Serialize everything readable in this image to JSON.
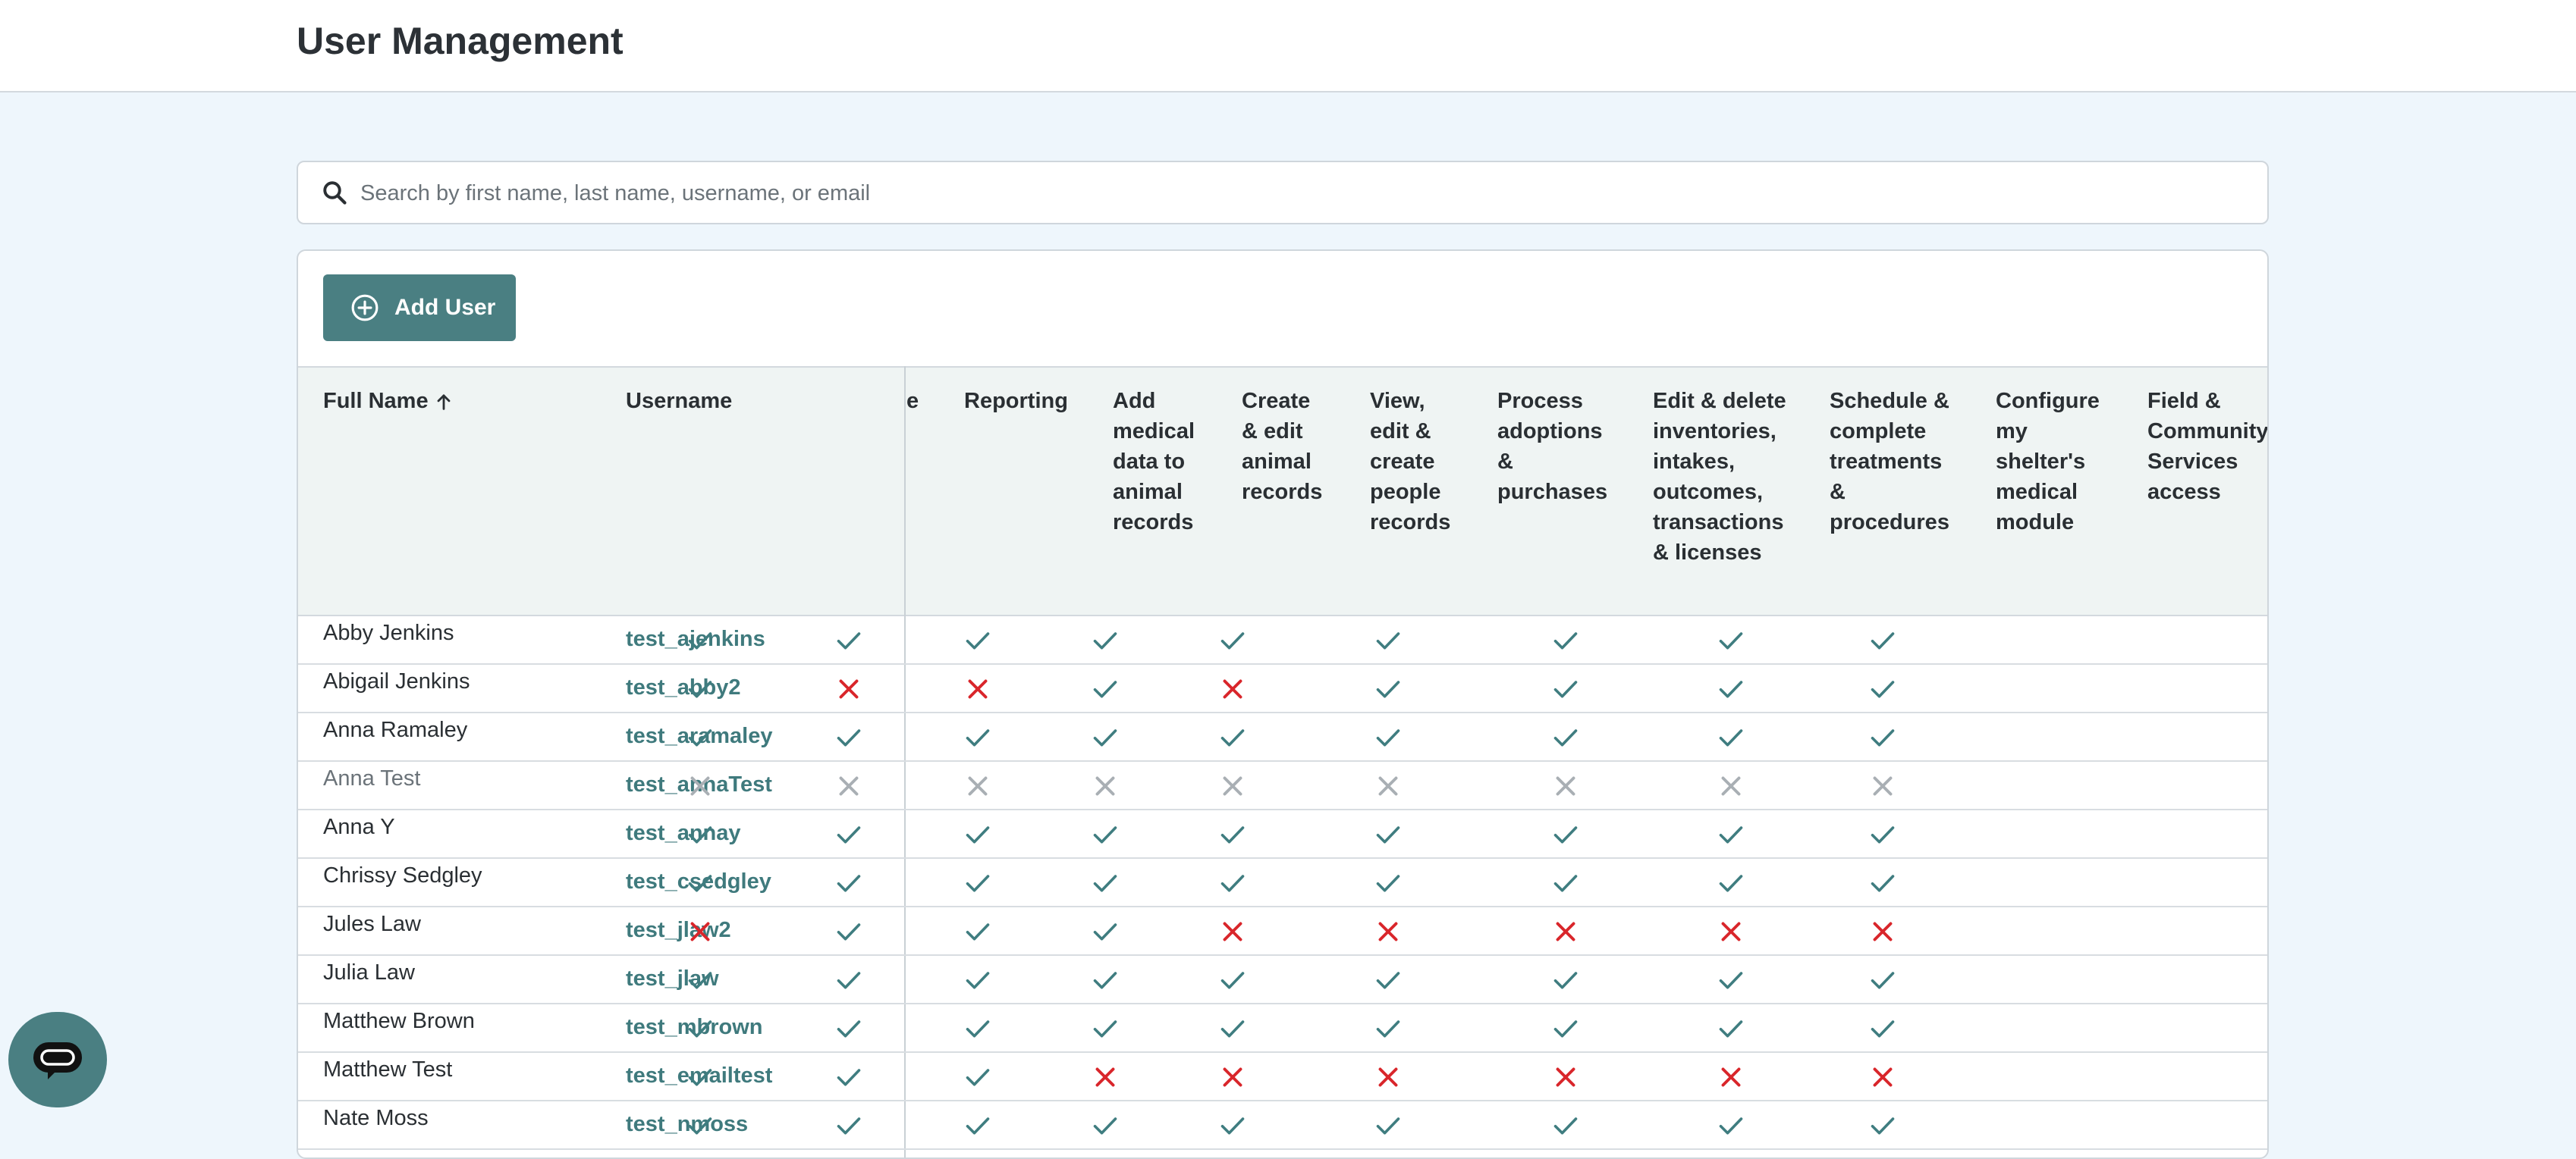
{
  "page": {
    "title": "User Management"
  },
  "search": {
    "placeholder": "Search by first name, last name, username, or email"
  },
  "toolbar": {
    "add_user_label": "Add User"
  },
  "table": {
    "columns": {
      "full_name": "Full Name",
      "username": "Username",
      "partial": "e",
      "permissions": [
        [
          "Reporting"
        ],
        [
          "Add",
          "medical",
          "data to",
          "animal",
          "records"
        ],
        [
          "Create",
          "& edit",
          "animal",
          "records"
        ],
        [
          "View,",
          "edit &",
          "create",
          "people",
          "records"
        ],
        [
          "Process",
          "adoptions",
          "&",
          "purchases"
        ],
        [
          "Edit & delete",
          "inventories,",
          "intakes,",
          "outcomes,",
          "transactions",
          "& licenses"
        ],
        [
          "Schedule &",
          "complete",
          "treatments",
          "&",
          "procedures"
        ],
        [
          "Configure",
          "my",
          "shelter's",
          "medical",
          "module"
        ],
        [
          "Field &",
          "Community",
          "Services",
          "access"
        ]
      ]
    },
    "sort": {
      "column": "Full Name",
      "direction": "ascending"
    },
    "rows": [
      {
        "full_name": "Abby Jenkins",
        "username": "test_ajenkins",
        "active": true,
        "perms": [
          1,
          1,
          1,
          1,
          1,
          1,
          1,
          1,
          1
        ]
      },
      {
        "full_name": "Abigail Jenkins",
        "username": "test_abby2",
        "active": true,
        "perms": [
          1,
          0,
          0,
          1,
          0,
          1,
          1,
          1,
          1
        ]
      },
      {
        "full_name": "Anna Ramaley",
        "username": "test_aramaley",
        "active": true,
        "perms": [
          1,
          1,
          1,
          1,
          1,
          1,
          1,
          1,
          1
        ]
      },
      {
        "full_name": "Anna Test",
        "username": "test_annaTest",
        "active": false,
        "perms": [
          0,
          0,
          0,
          0,
          0,
          0,
          0,
          0,
          0
        ]
      },
      {
        "full_name": "Anna Y",
        "username": "test_annay",
        "active": true,
        "perms": [
          1,
          1,
          1,
          1,
          1,
          1,
          1,
          1,
          1
        ]
      },
      {
        "full_name": "Chrissy Sedgley",
        "username": "test_csedgley",
        "active": true,
        "perms": [
          1,
          1,
          1,
          1,
          1,
          1,
          1,
          1,
          1
        ]
      },
      {
        "full_name": "Jules Law",
        "username": "test_jlaw2",
        "active": true,
        "perms": [
          0,
          1,
          1,
          1,
          0,
          0,
          0,
          0,
          0
        ]
      },
      {
        "full_name": "Julia Law",
        "username": "test_jlaw",
        "active": true,
        "perms": [
          1,
          1,
          1,
          1,
          1,
          1,
          1,
          1,
          1
        ]
      },
      {
        "full_name": "Matthew Brown",
        "username": "test_mbrown",
        "active": true,
        "perms": [
          1,
          1,
          1,
          1,
          1,
          1,
          1,
          1,
          1
        ]
      },
      {
        "full_name": "Matthew Test",
        "username": "test_emailtest",
        "active": true,
        "perms": [
          1,
          1,
          1,
          0,
          0,
          0,
          0,
          0,
          0
        ]
      },
      {
        "full_name": "Nate Moss",
        "username": "test_nmoss",
        "active": true,
        "perms": [
          1,
          1,
          1,
          1,
          1,
          1,
          1,
          1,
          1
        ]
      }
    ]
  },
  "icons": {
    "search": "search-icon",
    "add": "plus-circle-icon",
    "sort": "arrow-up-icon",
    "granted": "check-icon",
    "denied": "x-icon",
    "inactive": "x-icon-gray",
    "chat": "chat-bubble-icon"
  },
  "colors": {
    "granted": "#3f7d80",
    "denied": "#d9262b",
    "inactive": "#a9afb4",
    "accent": "#4a7f82"
  }
}
